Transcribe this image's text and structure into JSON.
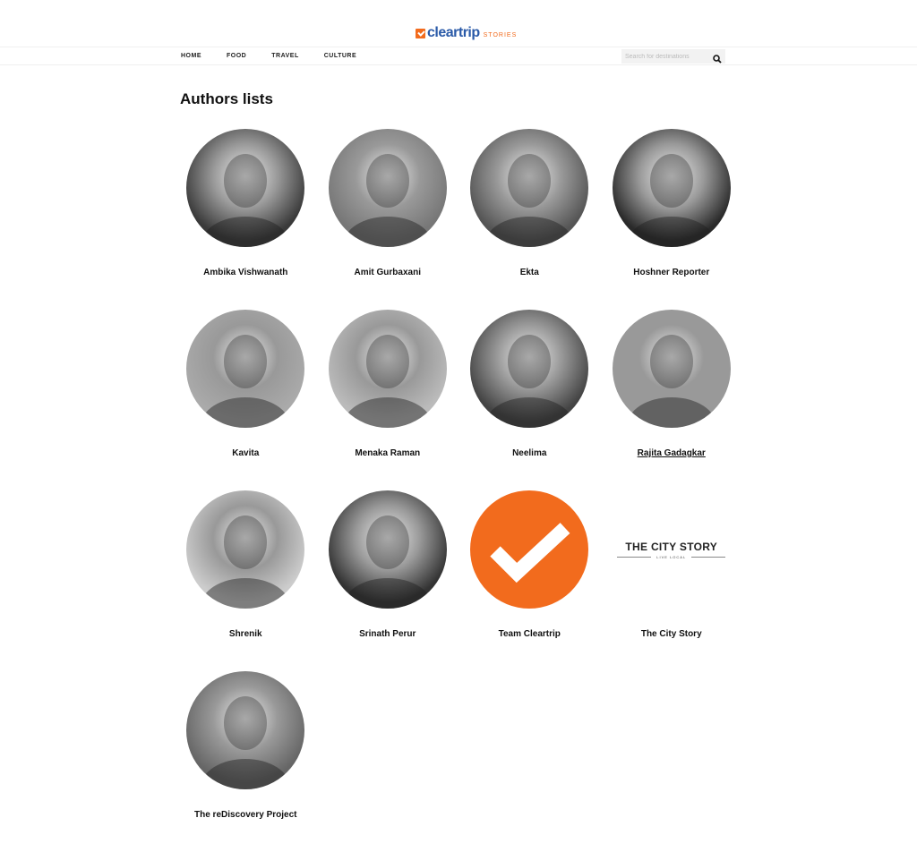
{
  "brand": {
    "name": "cleartrip",
    "sub": "STORIES",
    "accent": "#f26b1d",
    "blue": "#2a5aa8"
  },
  "nav": {
    "items": [
      "HOME",
      "FOOD",
      "TRAVEL",
      "CULTURE"
    ]
  },
  "search": {
    "placeholder": "Search for destinations",
    "value": ""
  },
  "page": {
    "title": "Authors lists"
  },
  "authors": [
    {
      "name": "Ambika Vishwanath",
      "tone": "#3a3a3a"
    },
    {
      "name": "Amit Gurbaxani",
      "tone": "#777"
    },
    {
      "name": "Ekta",
      "tone": "#555"
    },
    {
      "name": "Hoshner Reporter",
      "tone": "#2a2a2a"
    },
    {
      "name": "Kavita",
      "tone": "#aaa"
    },
    {
      "name": "Menaka Raman",
      "tone": "#bbb"
    },
    {
      "name": "Neelima",
      "tone": "#444"
    },
    {
      "name": "Rajita Gadagkar",
      "tone": "#999",
      "hovered": true
    },
    {
      "name": "Shrenik",
      "tone": "#ccc"
    },
    {
      "name": "Srinath Perur",
      "tone": "#333"
    },
    {
      "name": "Team Cleartrip",
      "tone": "#f26b1d",
      "logo": "check"
    },
    {
      "name": "The City Story",
      "logo": "city",
      "logo_title": "THE CITY STORY",
      "logo_sub": "LIVE LOCAL"
    },
    {
      "name": "The reDiscovery Project",
      "tone": "#666"
    }
  ]
}
